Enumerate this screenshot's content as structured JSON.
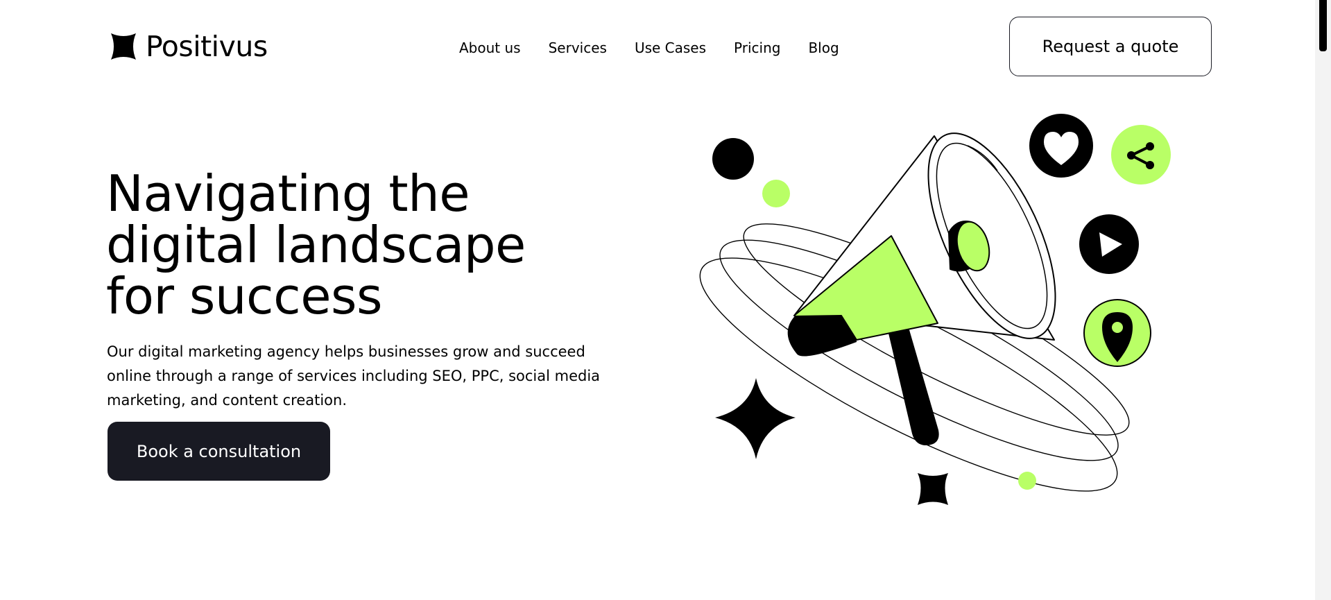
{
  "brand": {
    "name": "Positivus",
    "logo_icon": "four-point-star-icon"
  },
  "nav": {
    "items": [
      {
        "label": "About us"
      },
      {
        "label": "Services"
      },
      {
        "label": "Use Cases"
      },
      {
        "label": "Pricing"
      },
      {
        "label": "Blog"
      }
    ]
  },
  "header": {
    "cta_label": "Request a quote"
  },
  "hero": {
    "title_lines": [
      "Navigating the",
      "digital landscape",
      "for success"
    ],
    "description": "Our digital marketing agency helps businesses grow and succeed online through a range of services including SEO, PPC, social media marketing, and content creation.",
    "cta_label": "Book a consultation"
  },
  "illustration": {
    "name": "megaphone-illustration",
    "icons": [
      "heart-icon",
      "share-icon",
      "play-icon",
      "location-pin-icon",
      "sparkle-star-icon"
    ]
  },
  "colors": {
    "accent": "#B9FF66",
    "dark": "#191A23",
    "background": "#FFFFFF"
  }
}
